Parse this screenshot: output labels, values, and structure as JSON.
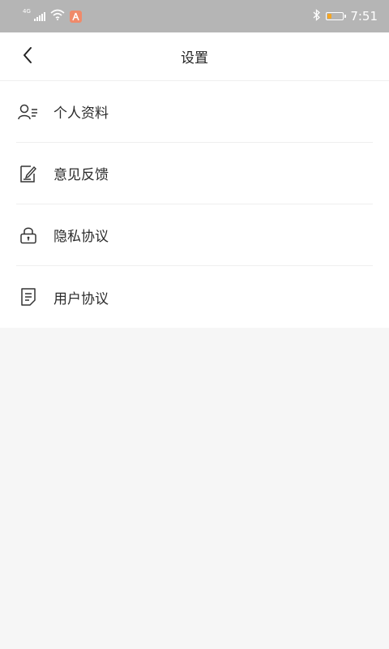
{
  "status_bar": {
    "network_label": "4G",
    "time": "7:51",
    "battery_level": 0.25,
    "battery_color": "#f5a623",
    "app_badge_color": "#f08a6a"
  },
  "header": {
    "title": "设置",
    "back_icon": "chevron-left-icon"
  },
  "menu": {
    "items": [
      {
        "label": "个人资料",
        "icon": "user-profile-icon"
      },
      {
        "label": "意见反馈",
        "icon": "feedback-icon"
      },
      {
        "label": "隐私协议",
        "icon": "lock-icon"
      },
      {
        "label": "用户协议",
        "icon": "document-icon"
      }
    ]
  }
}
